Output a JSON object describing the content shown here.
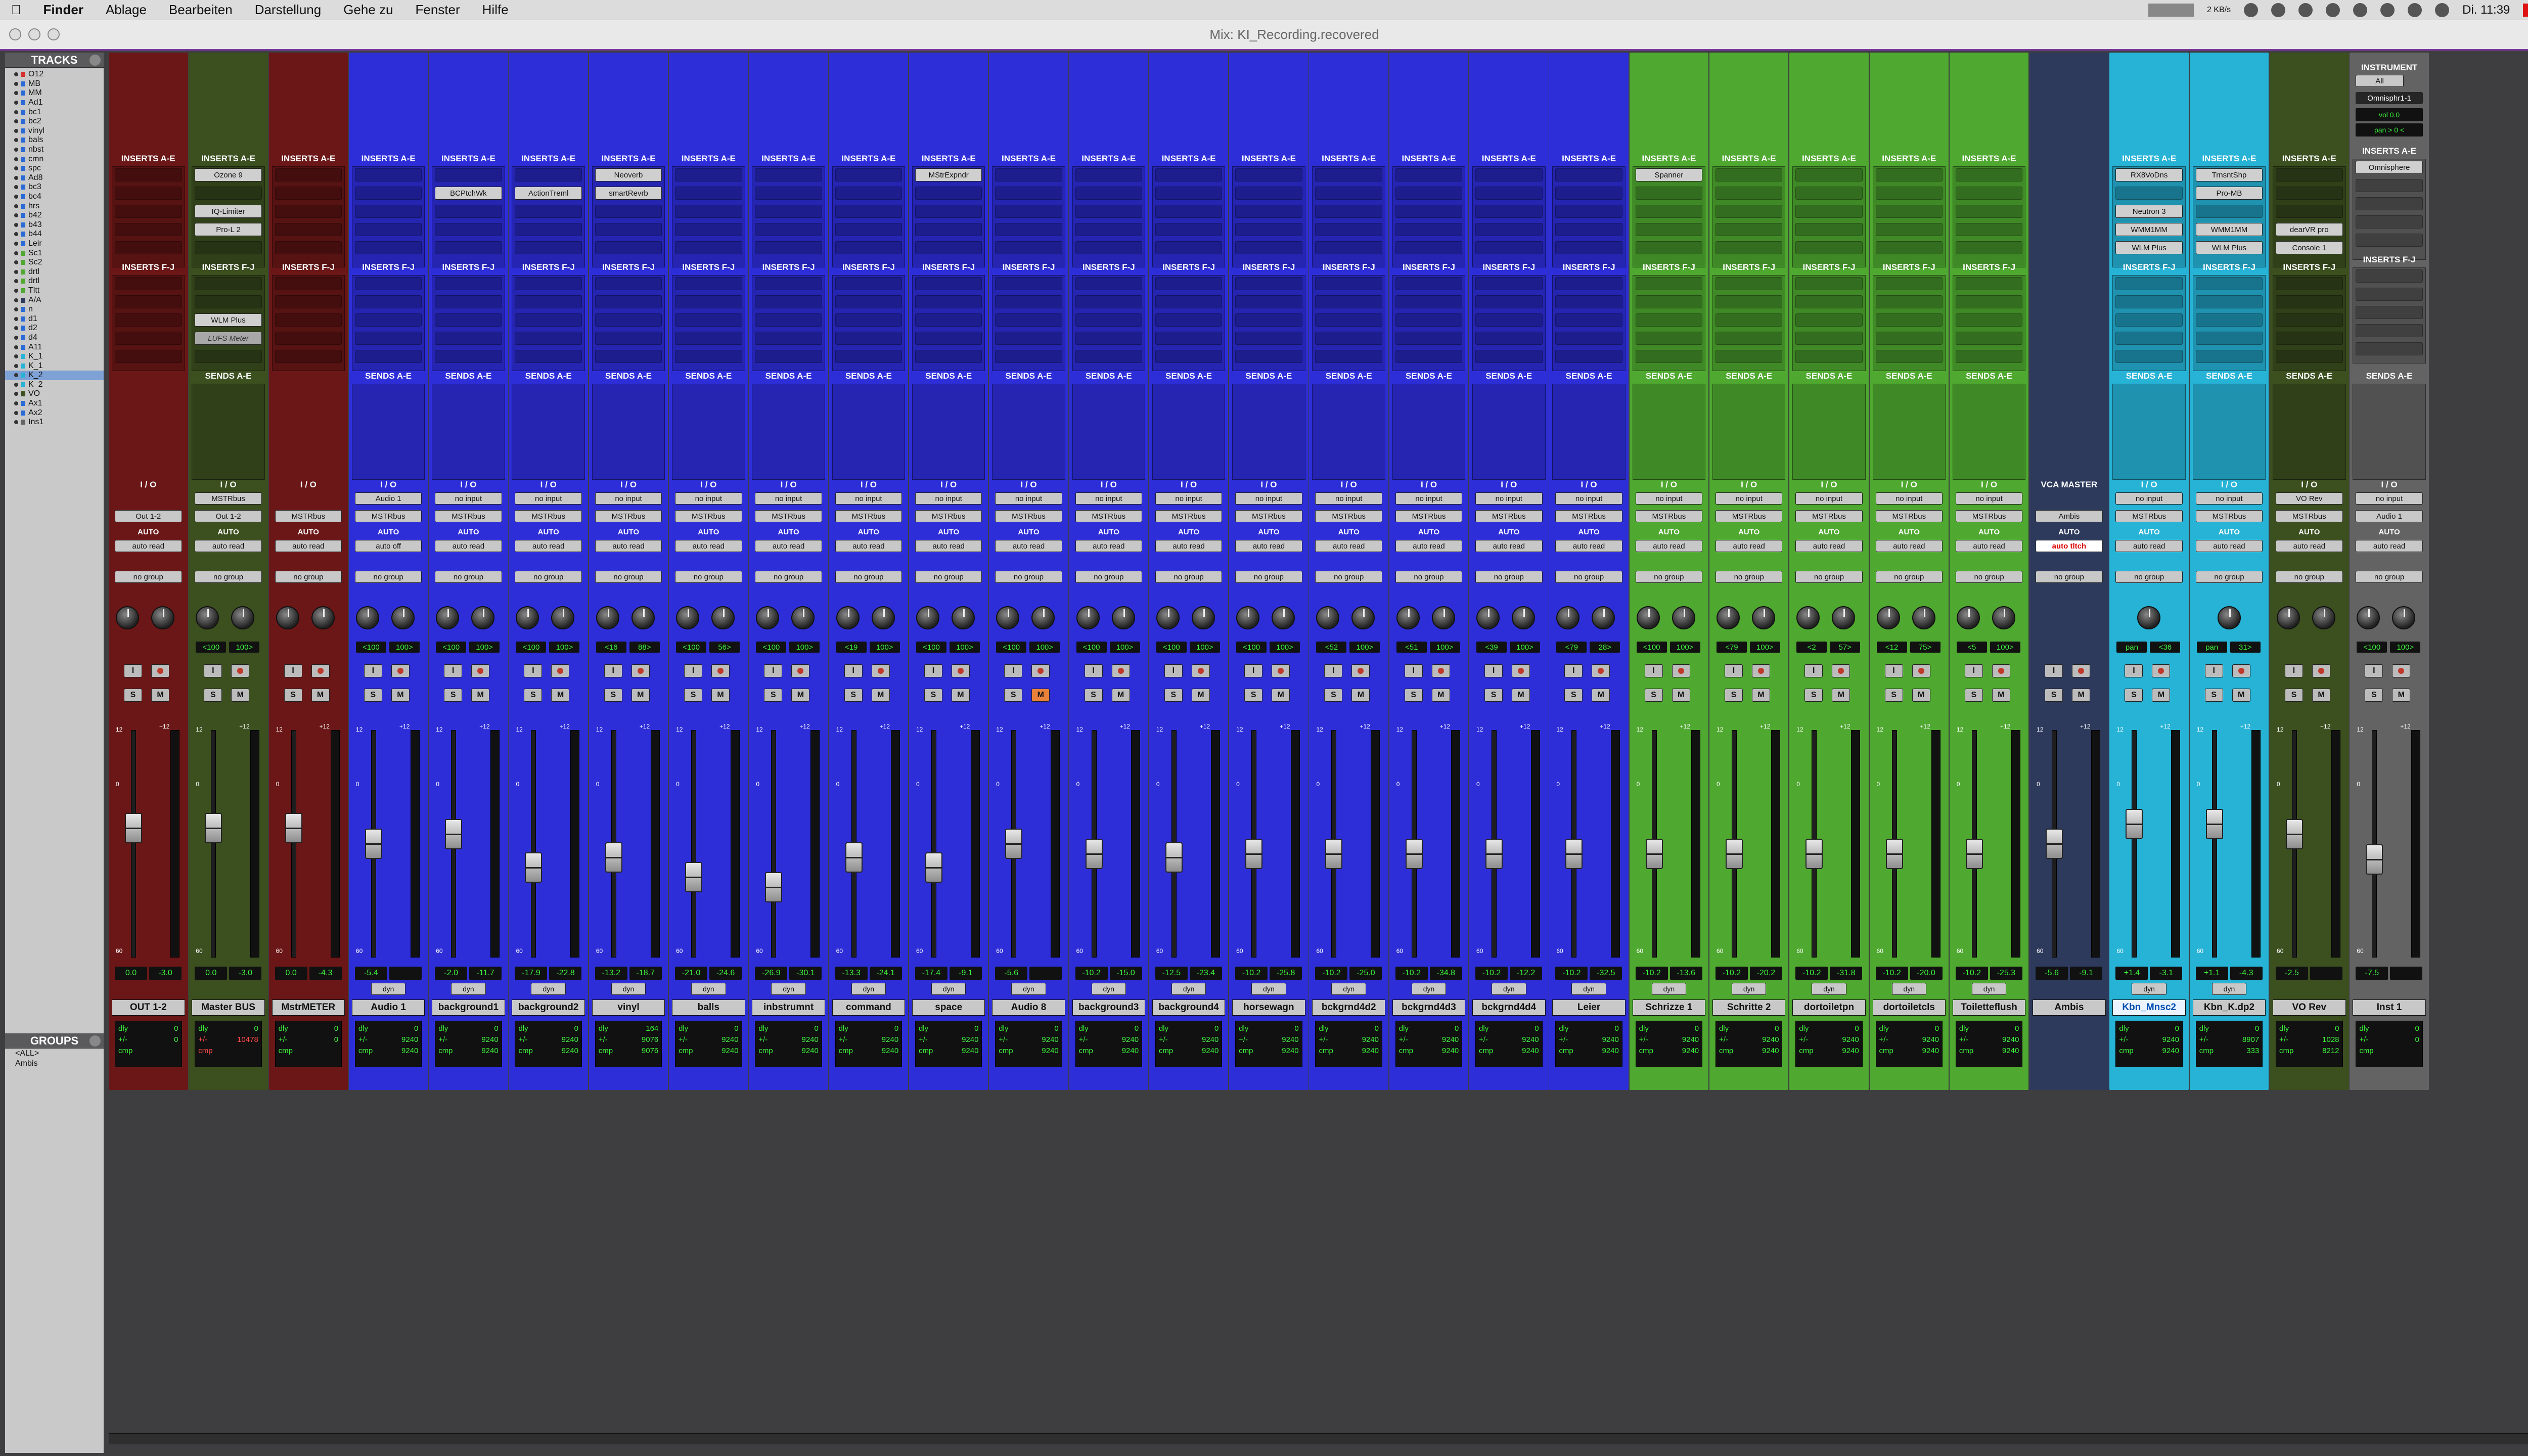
{
  "menubar": {
    "apple_icon": "apple-icon",
    "items": [
      "Finder",
      "Ablage",
      "Bearbeiten",
      "Darstellung",
      "Gehe zu",
      "Fenster",
      "Hilfe"
    ],
    "clock": "Di. 11:39",
    "net_rate": "2 KB/s"
  },
  "window": {
    "title": "Mix: KI_Recording.recovered"
  },
  "tracks_panel": {
    "title": "TRACKS",
    "items": [
      "O12",
      "MB",
      "MM",
      "Ad1",
      "bc1",
      "bc2",
      "vinyl",
      "bals",
      "nbst",
      "cmn",
      "spc",
      "Ad8",
      "bc3",
      "bc4",
      "hrs",
      "b42",
      "b43",
      "b44",
      "Leir",
      "Sc1",
      "Sc2",
      "drtl",
      "drtl",
      "Tltt",
      "A/A",
      "n",
      "d1",
      "d2",
      "d4",
      "A11",
      "K_1",
      "K_1",
      "K_2",
      "K_2",
      "VO",
      "Ax1",
      "Ax2",
      "Ins1"
    ],
    "selected_index": 32
  },
  "groups_panel": {
    "title": "GROUPS",
    "items": [
      "<ALL>",
      "Ambis"
    ]
  },
  "labels": {
    "inserts_ae": "INSERTS A-E",
    "inserts_fj": "INSERTS F-J",
    "sends_ae": "SENDS A-E",
    "io": "I / O",
    "auto": "AUTO",
    "vca_master": "VCA MASTER",
    "instrument": "INSTRUMENT",
    "dly": "dly",
    "pm": "+/-",
    "cmp": "cmp"
  },
  "strips": [
    {
      "name": "OUT 1-2",
      "color": "#6b1717",
      "in": "",
      "out": "Out 1-2",
      "auto": "auto read",
      "group": "no group",
      "pan": [
        "",
        ""
      ],
      "vol": "0.0",
      "peak": "-3.0",
      "mode": "",
      "ins": [],
      "insfj": [],
      "dly": "0",
      "cmp": "",
      "sends": false,
      "fader": 0.58,
      "meter": 0.0
    },
    {
      "name": "Master BUS",
      "color": "#3b4f1f",
      "in": "MSTRbus",
      "out": "Out 1-2",
      "auto": "auto read",
      "group": "no group",
      "pan": [
        "<100",
        "100>"
      ],
      "vol": "0.0",
      "peak": "-3.0",
      "mode": "",
      "ins": [
        "Ozone 9",
        "",
        "IQ-Limiter",
        "Pro-L 2"
      ],
      "insfj": [
        "",
        "",
        "WLM Plus",
        "LUFS Meter"
      ],
      "dly": "0",
      "dlyv": "10478",
      "cmp": "",
      "sends": true,
      "fader": 0.58,
      "meter": 0.0,
      "redrow": true
    },
    {
      "name": "MstrMETER",
      "color": "#6b1717",
      "in": "",
      "out": "MSTRbus",
      "auto": "auto read",
      "group": "no group",
      "pan": [
        "",
        ""
      ],
      "vol": "0.0",
      "peak": "-4.3",
      "mode": "",
      "ins": [],
      "insfj": [],
      "dly": "0",
      "cmp": "",
      "sends": false,
      "fader": 0.58,
      "meter": 0.0
    },
    {
      "name": "Audio 1",
      "color": "#2e2ed9",
      "in": "Audio 1",
      "out": "MSTRbus",
      "auto": "auto off",
      "group": "no group",
      "pan": [
        "<100",
        "100>"
      ],
      "vol": "-5.4",
      "peak": "",
      "mode": "dyn",
      "ins": [],
      "insfj": [],
      "dly": "0",
      "dlyv": "9240",
      "cmp": "9240",
      "sends": true,
      "fader": 0.5,
      "meter": 0.0
    },
    {
      "name": "background1",
      "color": "#2e2ed9",
      "in": "no input",
      "out": "MSTRbus",
      "auto": "auto read",
      "group": "no group",
      "pan": [
        "<100",
        "100>"
      ],
      "vol": "-2.0",
      "peak": "-11.7",
      "mode": "dyn",
      "ins": [
        "",
        "BCPtchWk"
      ],
      "insfj": [],
      "dly": "0",
      "dlyv": "9240",
      "cmp": "9240",
      "sends": true,
      "fader": 0.55,
      "meter": 0.0
    },
    {
      "name": "background2",
      "color": "#2e2ed9",
      "in": "no input",
      "out": "MSTRbus",
      "auto": "auto read",
      "group": "no group",
      "pan": [
        "<100",
        "100>"
      ],
      "vol": "-17.9",
      "peak": "-22.8",
      "mode": "dyn",
      "ins": [
        "",
        "ActionTreml"
      ],
      "insfj": [],
      "dly": "0",
      "dlyv": "9240",
      "cmp": "9240",
      "sends": true,
      "fader": 0.38,
      "meter": 0.0
    },
    {
      "name": "vinyl",
      "color": "#2e2ed9",
      "in": "no input",
      "out": "MSTRbus",
      "auto": "auto read",
      "group": "no group",
      "pan": [
        "<16",
        "88>"
      ],
      "vol": "-13.2",
      "peak": "-18.7",
      "mode": "dyn",
      "ins": [
        "Neoverb",
        "smartRevrb"
      ],
      "insfj": [],
      "dly": "164",
      "dlyv": "9076",
      "cmp": "9076",
      "sends": true,
      "fader": 0.43,
      "meter": 0.0
    },
    {
      "name": "balls",
      "color": "#2e2ed9",
      "in": "no input",
      "out": "MSTRbus",
      "auto": "auto read",
      "group": "no group",
      "pan": [
        "<100",
        "56>"
      ],
      "vol": "-21.0",
      "peak": "-24.6",
      "mode": "dyn",
      "ins": [],
      "insfj": [],
      "dly": "0",
      "dlyv": "9240",
      "cmp": "9240",
      "sends": true,
      "fader": 0.33,
      "meter": 0.0
    },
    {
      "name": "inbstrumnt",
      "color": "#2e2ed9",
      "in": "no input",
      "out": "MSTRbus",
      "auto": "auto read",
      "group": "no group",
      "pan": [
        "<100",
        "100>"
      ],
      "vol": "-26.9",
      "peak": "-30.1",
      "mode": "dyn",
      "ins": [],
      "insfj": [],
      "dly": "0",
      "dlyv": "9240",
      "cmp": "9240",
      "sends": true,
      "fader": 0.28,
      "meter": 0.0
    },
    {
      "name": "command",
      "color": "#2e2ed9",
      "in": "no input",
      "out": "MSTRbus",
      "auto": "auto read",
      "group": "no group",
      "pan": [
        "<19",
        "100>"
      ],
      "vol": "-13.3",
      "peak": "-24.1",
      "mode": "dyn",
      "ins": [],
      "insfj": [],
      "dly": "0",
      "dlyv": "9240",
      "cmp": "9240",
      "sends": true,
      "fader": 0.43,
      "meter": 0.0
    },
    {
      "name": "space",
      "color": "#2e2ed9",
      "in": "no input",
      "out": "MSTRbus",
      "auto": "auto read",
      "group": "no group",
      "pan": [
        "<100",
        "100>"
      ],
      "vol": "-17.4",
      "peak": "-9.1",
      "mode": "dyn",
      "ins": [
        "MStrExpndr"
      ],
      "insfj": [],
      "dly": "0",
      "dlyv": "9240",
      "cmp": "9240",
      "sends": true,
      "fader": 0.38,
      "meter": 0.0
    },
    {
      "name": "Audio 8",
      "color": "#2e2ed9",
      "in": "no input",
      "out": "MSTRbus",
      "auto": "auto read",
      "group": "no group",
      "pan": [
        "<100",
        "100>"
      ],
      "vol": "-5.6",
      "peak": "",
      "mode": "dyn",
      "ins": [],
      "insfj": [],
      "dly": "0",
      "dlyv": "9240",
      "cmp": "9240",
      "sends": true,
      "fader": 0.5,
      "meter": 0.0,
      "mute": true
    },
    {
      "name": "background3",
      "color": "#2e2ed9",
      "in": "no input",
      "out": "MSTRbus",
      "auto": "auto read",
      "group": "no group",
      "pan": [
        "<100",
        "100>"
      ],
      "vol": "-10.2",
      "peak": "-15.0",
      "mode": "dyn",
      "ins": [],
      "insfj": [],
      "dly": "0",
      "dlyv": "9240",
      "cmp": "9240",
      "sends": true,
      "fader": 0.45,
      "meter": 0.0
    },
    {
      "name": "background4",
      "color": "#2e2ed9",
      "in": "no input",
      "out": "MSTRbus",
      "auto": "auto read",
      "group": "no group",
      "pan": [
        "<100",
        "100>"
      ],
      "vol": "-12.5",
      "peak": "-23.4",
      "mode": "dyn",
      "ins": [],
      "insfj": [],
      "dly": "0",
      "dlyv": "9240",
      "cmp": "9240",
      "sends": true,
      "fader": 0.43,
      "meter": 0.0
    },
    {
      "name": "horsewagn",
      "color": "#2e2ed9",
      "in": "no input",
      "out": "MSTRbus",
      "auto": "auto read",
      "group": "no group",
      "pan": [
        "<100",
        "100>"
      ],
      "vol": "-10.2",
      "peak": "-25.8",
      "mode": "dyn",
      "ins": [],
      "insfj": [],
      "dly": "0",
      "dlyv": "9240",
      "cmp": "9240",
      "sends": true,
      "fader": 0.45,
      "meter": 0.0
    },
    {
      "name": "bckgrnd4d2",
      "color": "#2e2ed9",
      "in": "no input",
      "out": "MSTRbus",
      "auto": "auto read",
      "group": "no group",
      "pan": [
        "<52",
        "100>"
      ],
      "vol": "-10.2",
      "peak": "-25.0",
      "mode": "dyn",
      "ins": [],
      "insfj": [],
      "dly": "0",
      "dlyv": "9240",
      "cmp": "9240",
      "sends": true,
      "fader": 0.45,
      "meter": 0.0
    },
    {
      "name": "bckgrnd4d3",
      "color": "#2e2ed9",
      "in": "no input",
      "out": "MSTRbus",
      "auto": "auto read",
      "group": "no group",
      "pan": [
        "<51",
        "100>"
      ],
      "vol": "-10.2",
      "peak": "-34.8",
      "mode": "dyn",
      "ins": [],
      "insfj": [],
      "dly": "0",
      "dlyv": "9240",
      "cmp": "9240",
      "sends": true,
      "fader": 0.45,
      "meter": 0.0
    },
    {
      "name": "bckgrnd4d4",
      "color": "#2e2ed9",
      "in": "no input",
      "out": "MSTRbus",
      "auto": "auto read",
      "group": "no group",
      "pan": [
        "<39",
        "100>"
      ],
      "vol": "-10.2",
      "peak": "-12.2",
      "mode": "dyn",
      "ins": [],
      "insfj": [],
      "dly": "0",
      "dlyv": "9240",
      "cmp": "9240",
      "sends": true,
      "fader": 0.45,
      "meter": 0.0
    },
    {
      "name": "Leier",
      "color": "#2e2ed9",
      "in": "no input",
      "out": "MSTRbus",
      "auto": "auto read",
      "group": "no group",
      "pan": [
        "<79",
        "28>"
      ],
      "vol": "-10.2",
      "peak": "-32.5",
      "mode": "dyn",
      "ins": [],
      "insfj": [],
      "dly": "0",
      "dlyv": "9240",
      "cmp": "9240",
      "sends": true,
      "fader": 0.45,
      "meter": 0.0
    },
    {
      "name": "Schrizze 1",
      "color": "#4fa830",
      "in": "no input",
      "out": "MSTRbus",
      "auto": "auto read",
      "group": "no group",
      "pan": [
        "<100",
        "100>"
      ],
      "vol": "-10.2",
      "peak": "-13.6",
      "mode": "dyn",
      "ins": [
        "Spanner"
      ],
      "insfj": [],
      "dly": "0",
      "dlyv": "9240",
      "cmp": "9240",
      "sends": true,
      "fader": 0.45,
      "meter": 0.0
    },
    {
      "name": "Schritte 2",
      "color": "#4fa830",
      "in": "no input",
      "out": "MSTRbus",
      "auto": "auto read",
      "group": "no group",
      "pan": [
        "<79",
        "100>"
      ],
      "vol": "-10.2",
      "peak": "-20.2",
      "mode": "dyn",
      "ins": [],
      "insfj": [],
      "dly": "0",
      "dlyv": "9240",
      "cmp": "9240",
      "sends": true,
      "fader": 0.45,
      "meter": 0.0
    },
    {
      "name": "dortoiletpn",
      "color": "#4fa830",
      "in": "no input",
      "out": "MSTRbus",
      "auto": "auto read",
      "group": "no group",
      "pan": [
        "<2",
        "57>"
      ],
      "vol": "-10.2",
      "peak": "-31.8",
      "mode": "dyn",
      "ins": [],
      "insfj": [],
      "dly": "0",
      "dlyv": "9240",
      "cmp": "9240",
      "sends": true,
      "fader": 0.45,
      "meter": 0.0
    },
    {
      "name": "dortoiletcls",
      "color": "#4fa830",
      "in": "no input",
      "out": "MSTRbus",
      "auto": "auto read",
      "group": "no group",
      "pan": [
        "<12",
        "75>"
      ],
      "vol": "-10.2",
      "peak": "-20.0",
      "mode": "dyn",
      "ins": [],
      "insfj": [],
      "dly": "0",
      "dlyv": "9240",
      "cmp": "9240",
      "sends": true,
      "fader": 0.45,
      "meter": 0.0
    },
    {
      "name": "Toiletteflush",
      "color": "#4fa830",
      "in": "no input",
      "out": "MSTRbus",
      "auto": "auto read",
      "group": "no group",
      "pan": [
        "<5",
        "100>"
      ],
      "vol": "-10.2",
      "peak": "-25.3",
      "mode": "dyn",
      "ins": [],
      "insfj": [],
      "dly": "0",
      "dlyv": "9240",
      "cmp": "9240",
      "sends": true,
      "fader": 0.45,
      "meter": 0.0
    },
    {
      "name": "Ambis",
      "color": "#2d3a5c",
      "vca": true,
      "in": "",
      "out": "Ambis",
      "auto": "auto tltch",
      "group": "no group",
      "pan": [
        "",
        ""
      ],
      "vol": "-5.6",
      "peak": "-9.1",
      "mode": "",
      "ins": [],
      "insfj": [],
      "dly": "",
      "cmp": "",
      "sends": false,
      "fader": 0.5,
      "meter": 0.0
    },
    {
      "name": "Kbn_Mnsc2",
      "color": "#27b3d6",
      "in": "no input",
      "out": "MSTRbus",
      "auto": "auto read",
      "group": "no group",
      "pan": [
        "pan",
        "<36"
      ],
      "vol": "+1.4",
      "peak": "-3.1",
      "mode": "dyn",
      "ins": [
        "RX8VoDns",
        "",
        "Neutron 3",
        "WMM1MM",
        "WLM Plus"
      ],
      "insfj": [],
      "dly": "0",
      "dlyv": "9240",
      "cmp": "9240",
      "sends": true,
      "fader": 0.6,
      "meter": 0.0,
      "selected": true,
      "mono": true
    },
    {
      "name": "Kbn_K.dp2",
      "color": "#27b3d6",
      "in": "no input",
      "out": "MSTRbus",
      "auto": "auto read",
      "group": "no group",
      "pan": [
        "pan",
        "31>"
      ],
      "vol": "+1.1",
      "peak": "-4.3",
      "mode": "dyn",
      "ins": [
        "TrnsntShp",
        "Pro-MB",
        "",
        "WMM1MM",
        "WLM Plus"
      ],
      "insfj": [],
      "dly": "0",
      "dlyv": "8907",
      "cmp": "333",
      "sends": true,
      "fader": 0.6,
      "meter": 0.0,
      "mono": true
    },
    {
      "name": "VO Rev",
      "color": "#3b4f1f",
      "in": "VO Rev",
      "out": "MSTRbus",
      "auto": "auto read",
      "group": "no group",
      "pan": [
        "",
        ""
      ],
      "vol": "-2.5",
      "peak": "",
      "mode": "",
      "ins": [
        "",
        "",
        "",
        "dearVR pro",
        "Console 1"
      ],
      "insfj": [],
      "dly": "0",
      "dlyv": "1028",
      "cmp": "8212",
      "sends": true,
      "fader": 0.55,
      "meter": 0.0
    },
    {
      "name": "Inst 1",
      "color": "#636363",
      "inst": true,
      "in": "no input",
      "out": "Audio 1",
      "auto": "auto read",
      "group": "no group",
      "pan": [
        "<100",
        "100>"
      ],
      "vol": "-7.5",
      "peak": "",
      "mode": "",
      "ins": [
        "Omnisphere"
      ],
      "insfj": [],
      "dly": "0",
      "dlyv": "",
      "cmp": "",
      "sends": true,
      "fader": 0.42,
      "meter": 0.0
    }
  ],
  "instrument_header": {
    "label": "INSTRUMENT",
    "all": "All",
    "plugin": "Omnisphr1-1",
    "vol": "vol 0.0",
    "pan": "pan > 0 <"
  }
}
